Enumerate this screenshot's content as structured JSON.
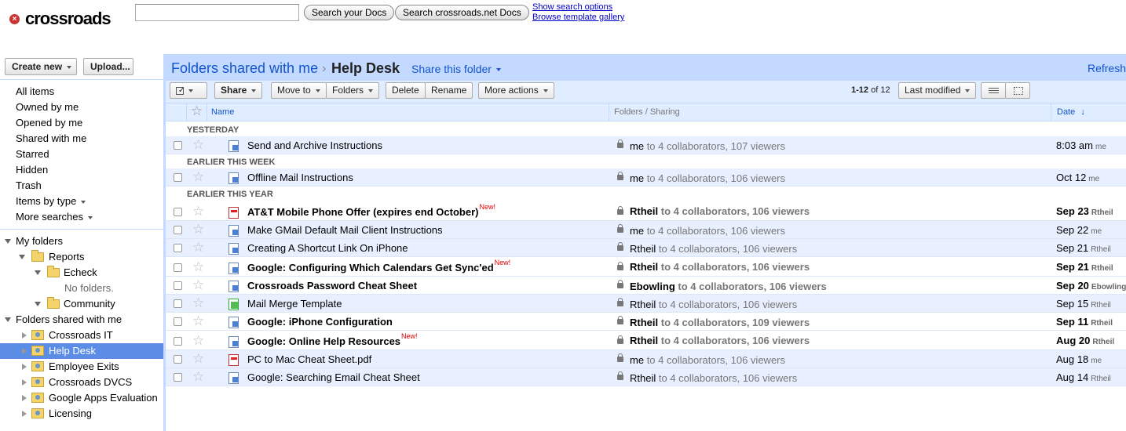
{
  "brand": {
    "mark": "×",
    "name": "crossroads"
  },
  "search": {
    "value": "",
    "btn_docs": "Search your Docs",
    "btn_net": "Search crossroads.net Docs",
    "link_options": "Show search options",
    "link_gallery": "Browse template gallery"
  },
  "sidebar": {
    "create": "Create new",
    "upload": "Upload...",
    "nav": [
      "All items",
      "Owned by me",
      "Opened by me",
      "Shared with me",
      "Starred",
      "Hidden",
      "Trash",
      "Items by type",
      "More searches"
    ],
    "my_folders": "My folders",
    "reports": "Reports",
    "echeck": "Echeck",
    "no_folders": "No folders.",
    "community": "Community",
    "shared_root": "Folders shared with me",
    "shared": [
      "Crossroads IT",
      "Help Desk",
      "Employee Exits",
      "Crossroads DVCS",
      "Google Apps Evaluation",
      "Licensing"
    ]
  },
  "header": {
    "crumb1": "Folders shared with me",
    "crumb_sep": "›",
    "crumb2": "Help Desk",
    "share_folder": "Share this folder",
    "refresh": "Refresh"
  },
  "toolbar": {
    "share": "Share",
    "move_to": "Move to",
    "folders": "Folders",
    "delete": "Delete",
    "rename": "Rename",
    "more_actions": "More actions",
    "count_range": "1-12",
    "count_total": "of 12",
    "sort": "Last modified"
  },
  "columns": {
    "name": "Name",
    "sharing": "Folders / Sharing",
    "date": "Date",
    "date_sort": "↓"
  },
  "groups": {
    "g1": "YESTERDAY",
    "g2": "EARLIER THIS WEEK",
    "g3": "EARLIER THIS YEAR"
  },
  "new_tag": "New!",
  "rows": [
    {
      "name": "Send and Archive Instructions",
      "owner": "me",
      "share": "to 4 collaborators, 107 viewers",
      "date": "8:03 am",
      "by": "me"
    },
    {
      "name": "Offline Mail Instructions",
      "owner": "me",
      "share": "to 4 collaborators, 106 viewers",
      "date": "Oct 12",
      "by": "me"
    },
    {
      "name": "AT&T Mobile Phone Offer (expires end October)",
      "owner": "Rtheil",
      "share": "to 4 collaborators, 106 viewers",
      "date": "Sep 23",
      "by": "Rtheil"
    },
    {
      "name": "Make GMail Default Mail Client Instructions",
      "owner": "me",
      "share": "to 4 collaborators, 106 viewers",
      "date": "Sep 22",
      "by": "me"
    },
    {
      "name": "Creating A Shortcut Link On iPhone",
      "owner": "Rtheil",
      "share": "to 4 collaborators, 106 viewers",
      "date": "Sep 21",
      "by": "Rtheil"
    },
    {
      "name": "Google: Configuring Which Calendars Get Sync'ed",
      "owner": "Rtheil",
      "share": "to 4 collaborators, 106 viewers",
      "date": "Sep 21",
      "by": "Rtheil"
    },
    {
      "name": "Crossroads Password Cheat Sheet",
      "owner": "Ebowling",
      "share": "to 4 collaborators, 106 viewers",
      "date": "Sep 20",
      "by": "Ebowling"
    },
    {
      "name": "Mail Merge Template",
      "owner": "Rtheil",
      "share": "to 4 collaborators, 106 viewers",
      "date": "Sep 15",
      "by": "Rtheil"
    },
    {
      "name": "Google: iPhone Configuration",
      "owner": "Rtheil",
      "share": "to 4 collaborators, 109 viewers",
      "date": "Sep 11",
      "by": "Rtheil"
    },
    {
      "name": "Google: Online Help Resources",
      "owner": "Rtheil",
      "share": "to 4 collaborators, 106 viewers",
      "date": "Aug 20",
      "by": "Rtheil"
    },
    {
      "name": "PC to Mac Cheat Sheet.pdf",
      "owner": "me",
      "share": "to 4 collaborators, 106 viewers",
      "date": "Aug 18",
      "by": "me"
    },
    {
      "name": "Google: Searching Email Cheat Sheet",
      "owner": "Rtheil",
      "share": "to 4 collaborators, 106 viewers",
      "date": "Aug 14",
      "by": "Rtheil"
    }
  ]
}
